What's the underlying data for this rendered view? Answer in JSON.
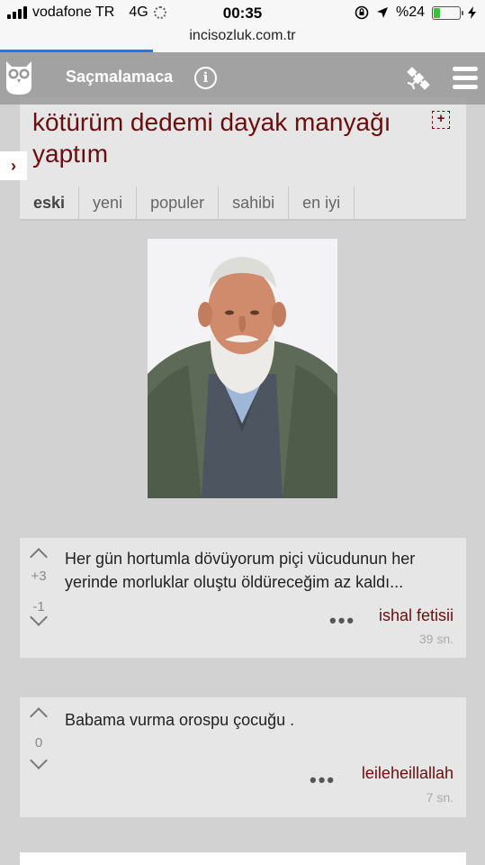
{
  "status_bar": {
    "carrier": "vodafone TR",
    "network": "4G",
    "time": "00:35",
    "battery": "%24",
    "battery_level": 0.24
  },
  "url_bar": {
    "domain": "incisozluk.com.tr"
  },
  "nav": {
    "site_title": "Saçmalamaca",
    "info_label": "i",
    "icons": [
      "owl-logo",
      "info-icon",
      "satellite-icon",
      "hamburger-menu-icon"
    ]
  },
  "topic": {
    "title": "kötürüm dedemi dayak manyağı yaptım",
    "follow_symbol": "+",
    "tabs": [
      "eski",
      "yeni",
      "populer",
      "sahibi",
      "en iyi"
    ],
    "active_tab": "eski"
  },
  "side_tab_symbol": "›",
  "entries": [
    {
      "upvotes": "+3",
      "downvotes": "-1",
      "text": "Her gün hortumla dövüyorum piçi vücudunun her yerinde morluklar oluştu öldüreceğim az kaldı...",
      "menu": "•••",
      "author": "ishal fetisii",
      "time": "39 sn."
    },
    {
      "score": "0",
      "text": "Babama vurma orospu çocuğu .",
      "menu": "•••",
      "author": "leileheillallah",
      "time": "7 sn."
    }
  ],
  "colors": {
    "accent": "#6b0d0d",
    "background": "#d2d2d2",
    "card": "#e6e6e6",
    "progress": "#1a7cf5"
  }
}
